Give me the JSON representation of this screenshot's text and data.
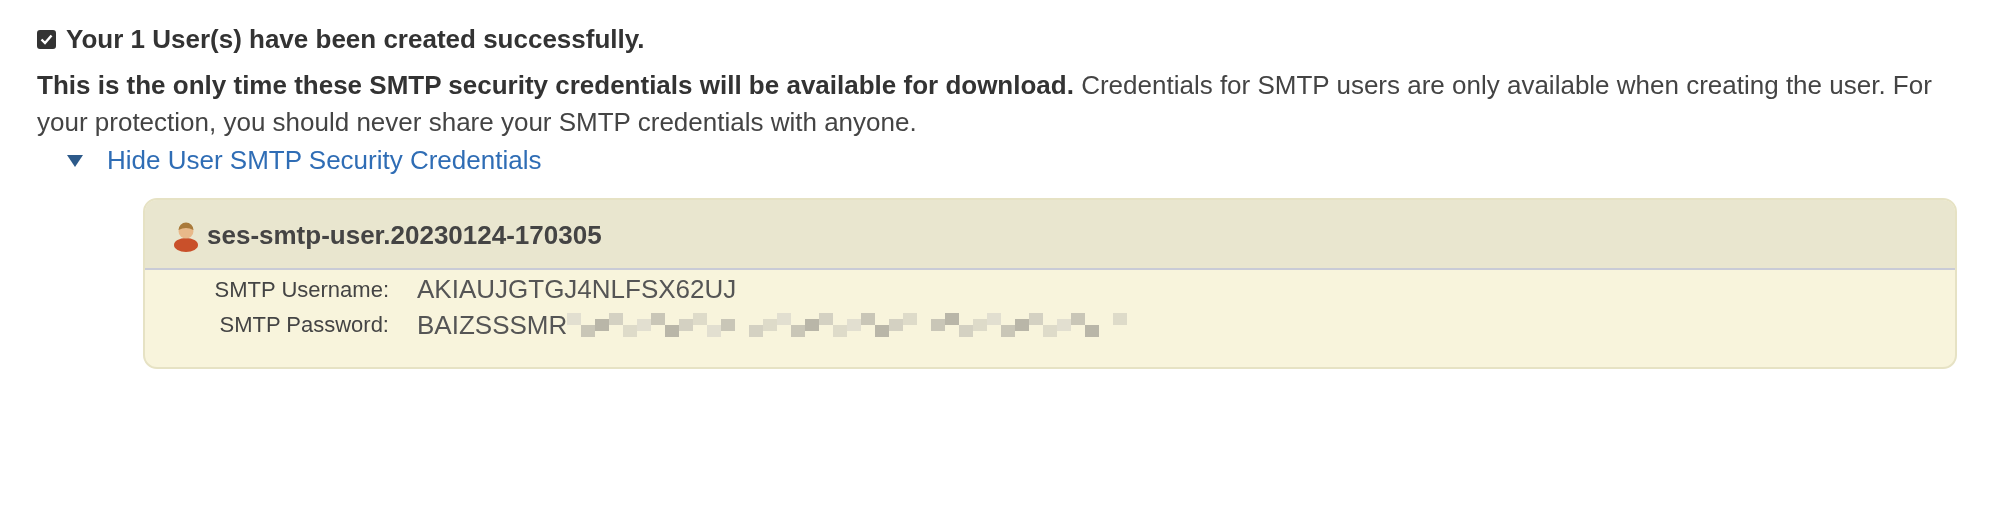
{
  "success_message": {
    "checked": true,
    "text": "Your 1 User(s) have been created successfully."
  },
  "notice": "**This is the only time these SMTP security credentials will be available for download.** Credentials for SMTP users are only available when creating the user. For your protection, you should never share your SMTP credentials with anyone.",
  "credentials_toggle": {
    "label": "Hide User SMTP Security Credentials",
    "expanded": true
  },
  "user_card": {
    "user_name": "ses-smtp-user.20230124-170305",
    "fields": [
      {
        "label": "SMTP Username:",
        "value": "AKIAUJGTGJ4NLFSX62UJ",
        "redacted": false
      },
      {
        "label": "SMTP Password:",
        "value": "BAIZSSSMR",
        "redacted": true
      }
    ]
  }
}
